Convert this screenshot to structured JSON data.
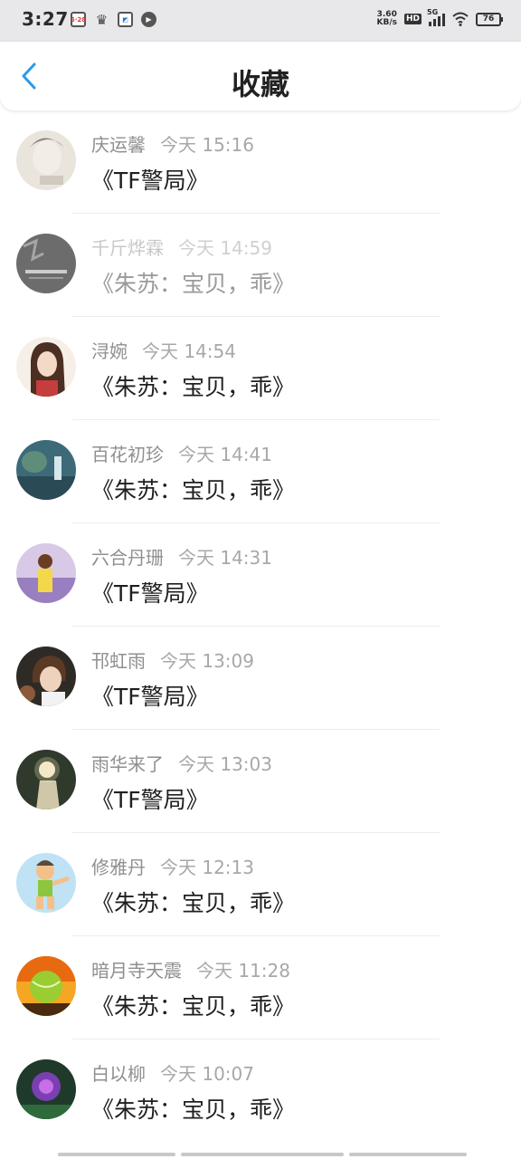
{
  "status_bar": {
    "time": "3:27",
    "icons": [
      "calendar-icon",
      "crown-icon",
      "app-icon",
      "play-icon"
    ],
    "calendar_label": "5·28",
    "net_speed_value": "3.60",
    "net_speed_unit": "KB/s",
    "hd_label": "HD",
    "network_label": "5G",
    "battery": "76"
  },
  "header": {
    "title": "收藏",
    "accent_color": "#2a9ae8"
  },
  "items": [
    {
      "username": "庆运馨",
      "time": "今天 15:16",
      "title": "《TF警局》"
    },
    {
      "username": "千斤烨霖",
      "time": "今天 14:59",
      "title": "《朱苏：宝贝，乖》"
    },
    {
      "username": "浔婉",
      "time": "今天 14:54",
      "title": "《朱苏：宝贝，乖》"
    },
    {
      "username": "百花初珍",
      "time": "今天 14:41",
      "title": "《朱苏：宝贝，乖》"
    },
    {
      "username": "六合丹珊",
      "time": "今天 14:31",
      "title": "《TF警局》"
    },
    {
      "username": "邗虹雨",
      "time": "今天 13:09",
      "title": "《TF警局》"
    },
    {
      "username": "雨华来了",
      "time": "今天 13:03",
      "title": "《TF警局》"
    },
    {
      "username": "修雅丹",
      "time": "今天 12:13",
      "title": "《朱苏：宝贝，乖》"
    },
    {
      "username": "暗月寺天震",
      "time": "今天 11:28",
      "title": "《朱苏：宝贝，乖》"
    },
    {
      "username": "白以柳",
      "time": "今天 10:07",
      "title": "《朱苏：宝贝，乖》"
    }
  ]
}
